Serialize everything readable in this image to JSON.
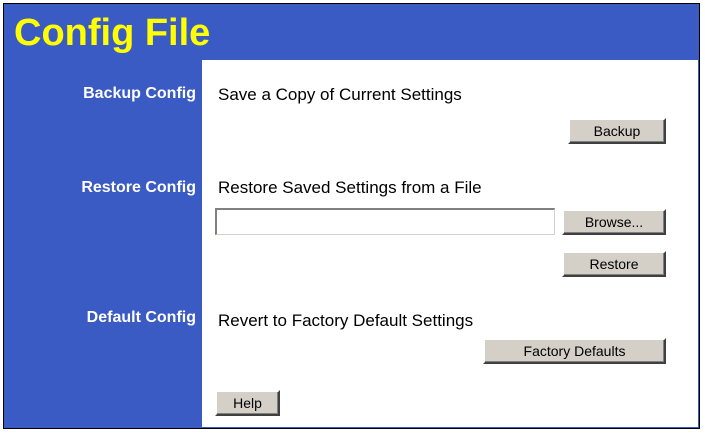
{
  "page": {
    "title": "Config File"
  },
  "sections": {
    "backup": {
      "label": "Backup Config",
      "description": "Save a Copy of Current Settings",
      "button": "Backup"
    },
    "restore": {
      "label": "Restore Config",
      "description": "Restore Saved Settings from a File",
      "file_value": "",
      "browse_button": "Browse...",
      "restore_button": "Restore"
    },
    "default": {
      "label": "Default Config",
      "description": "Revert to Factory Default Settings",
      "button": "Factory Defaults"
    }
  },
  "footer": {
    "help_button": "Help"
  },
  "colors": {
    "header_bg": "#3a5ac4",
    "title": "#ffff00",
    "sidebar_text": "#ffffff",
    "content_bg": "#ffffff"
  }
}
